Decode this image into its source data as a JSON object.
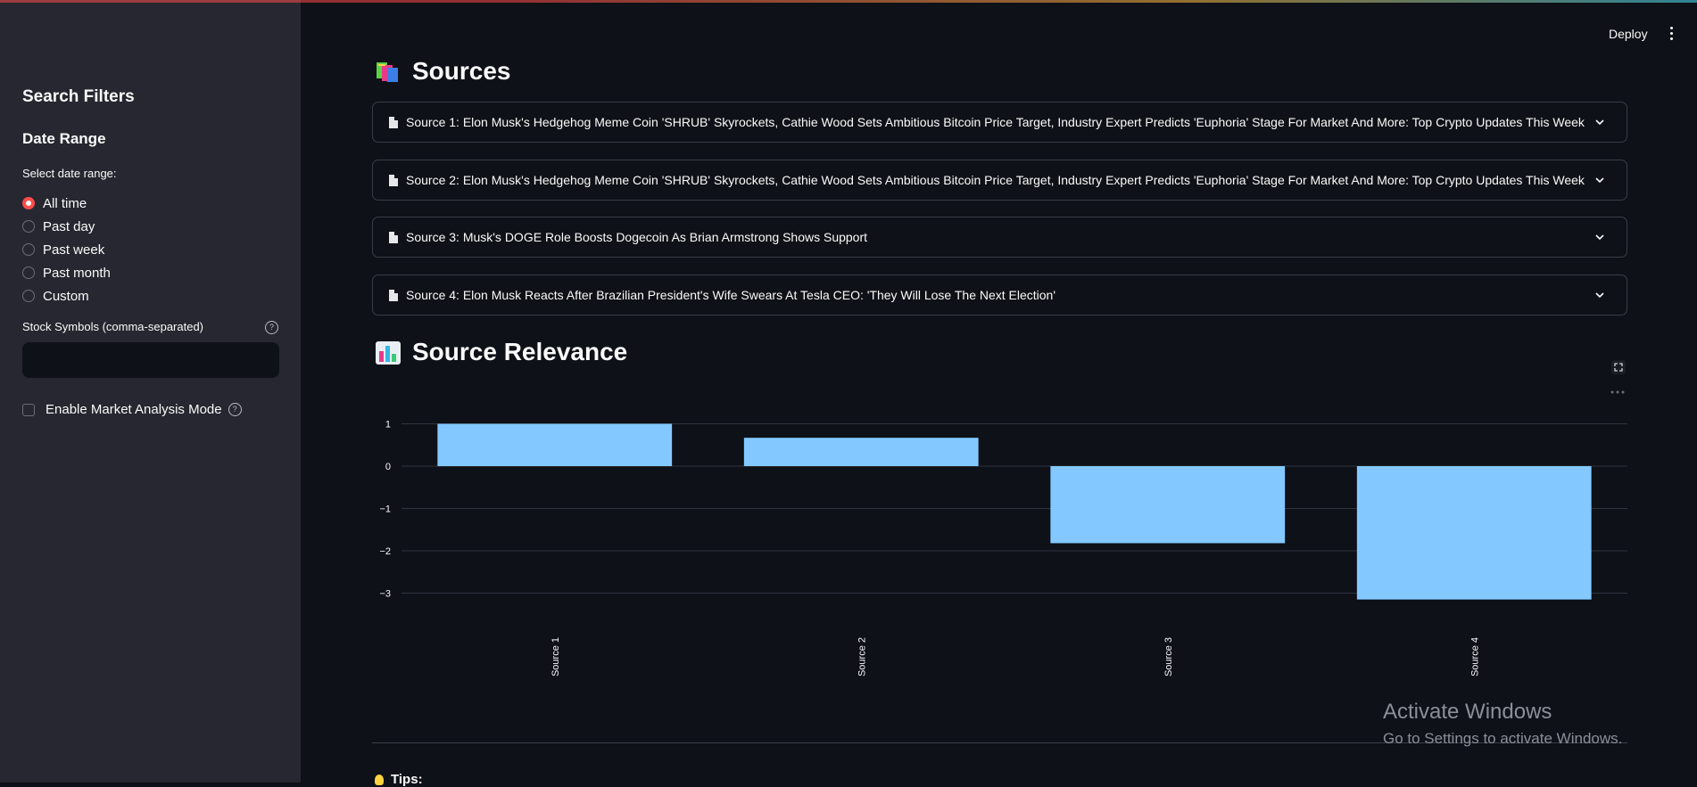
{
  "sidebar": {
    "title": "Search Filters",
    "date_range_heading": "Date Range",
    "date_range_label": "Select date range:",
    "date_options": [
      "All time",
      "Past day",
      "Past week",
      "Past month",
      "Custom"
    ],
    "selected_option": "All time",
    "stock_symbols_label": "Stock Symbols (comma-separated)",
    "stock_symbols_value": "",
    "market_mode_label": "Enable Market Analysis Mode",
    "market_mode_checked": false
  },
  "header": {
    "deploy_label": "Deploy"
  },
  "sources_section": {
    "heading": "Sources",
    "items": [
      "Source 1: Elon Musk's Hedgehog Meme Coin 'SHRUB' Skyrockets, Cathie Wood Sets Ambitious Bitcoin Price Target, Industry Expert Predicts 'Euphoria' Stage For Market And More: Top Crypto Updates This Week",
      "Source 2: Elon Musk's Hedgehog Meme Coin 'SHRUB' Skyrockets, Cathie Wood Sets Ambitious Bitcoin Price Target, Industry Expert Predicts 'Euphoria' Stage For Market And More: Top Crypto Updates This Week",
      "Source 3: Musk's DOGE Role Boosts Dogecoin As Brian Armstrong Shows Support",
      "Source 4: Elon Musk Reacts After Brazilian President's Wife Swears At Tesla CEO: 'They Will Lose The Next Election'"
    ]
  },
  "relevance_section": {
    "heading": "Source Relevance"
  },
  "tips_label": "Tips:",
  "watermark": {
    "title": "Activate Windows",
    "subtitle": "Go to Settings to activate Windows."
  },
  "colors": {
    "accent": "#ff4b4b",
    "bar": "#83c9ff",
    "background": "#0e1117",
    "sidebar": "#262730"
  },
  "chart_data": {
    "type": "bar",
    "categories": [
      "Source 1",
      "Source 2",
      "Source 3",
      "Source 4"
    ],
    "values": [
      1.0,
      0.67,
      -1.82,
      -3.15
    ],
    "yticks": [
      1,
      0,
      -1,
      -2,
      -3
    ],
    "ylim": [
      -3.15,
      1.0
    ],
    "grid": true,
    "xlabel": "",
    "ylabel": ""
  }
}
